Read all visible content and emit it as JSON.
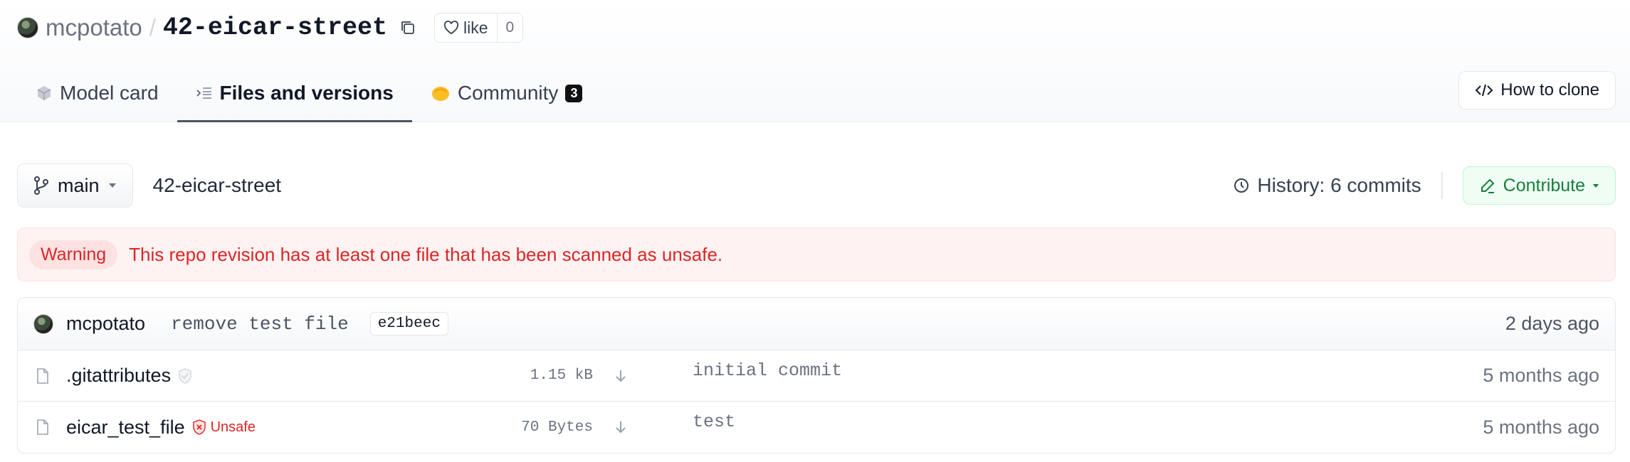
{
  "repo": {
    "owner": "mcpotato",
    "separator": "/",
    "name": "42-eicar-street",
    "like_label": "like",
    "like_count": "0"
  },
  "tabs": [
    {
      "label": "Model card",
      "icon": "cube-icon"
    },
    {
      "label": "Files and versions",
      "icon": "files-icon",
      "active": true
    },
    {
      "label": "Community",
      "icon": "community-icon",
      "badge": "3"
    }
  ],
  "clone_label": "How to clone",
  "branch": {
    "name": "main",
    "path": "42-eicar-street",
    "history": "History: 6 commits",
    "contribute": "Contribute"
  },
  "warning": {
    "tag": "Warning",
    "text": "This repo revision has at least one file that has been scanned as unsafe."
  },
  "last_commit": {
    "author": "mcpotato",
    "message": "remove test file",
    "sha": "e21beec",
    "time": "2 days ago"
  },
  "files": [
    {
      "name": ".gitattributes",
      "size": "1.15 kB",
      "message": "initial commit",
      "time": "5 months ago",
      "status": "safe"
    },
    {
      "name": "eicar_test_file",
      "size": "70 Bytes",
      "message": "test",
      "time": "5 months ago",
      "status": "unsafe",
      "status_label": "Unsafe"
    }
  ],
  "colors": {
    "danger": "#dc2626",
    "success": "#15803d",
    "badge": "#111111"
  }
}
